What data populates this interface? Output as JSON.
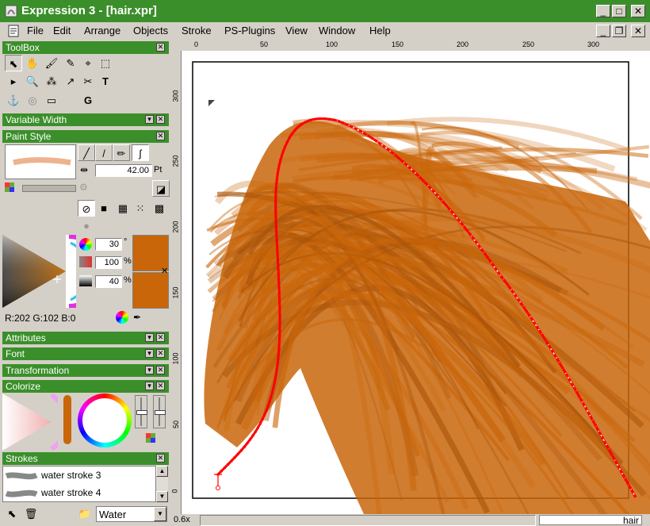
{
  "window": {
    "title": "Expression 3 - [hair.xpr]"
  },
  "menu": [
    "File",
    "Edit",
    "Arrange",
    "Objects",
    "Stroke",
    "PS-Plugins",
    "View",
    "Window",
    "Help"
  ],
  "panels": {
    "toolbox": "ToolBox",
    "variable_width": "Variable Width",
    "paint_style": "Paint Style",
    "attributes": "Attributes",
    "font": "Font",
    "transformation": "Transformation",
    "colorize": "Colorize",
    "strokes": "Strokes"
  },
  "paint_style": {
    "width_value": "42.00",
    "width_unit": "Pt",
    "hue": "30",
    "hue_unit": "°",
    "saturation": "100",
    "saturation_unit": "%",
    "lightness": "40",
    "lightness_unit": "%",
    "rgb_readout": "R:202  G:102  B:0",
    "color": "#c9660a"
  },
  "strokes": {
    "items": [
      {
        "label": "water stroke 3"
      },
      {
        "label": "water stroke 4"
      }
    ],
    "category": "Water"
  },
  "ruler": {
    "horizontal": [
      "0",
      "50",
      "100",
      "150",
      "200",
      "250",
      "300"
    ],
    "vertical": [
      "300",
      "250",
      "200",
      "150",
      "100",
      "50",
      "0"
    ]
  },
  "status": {
    "zoom": "0.6x",
    "object_name": "hair"
  },
  "colors": {
    "title_green": "#3b8f2a",
    "hair": "#c9660a",
    "path_red": "#ff0000"
  }
}
